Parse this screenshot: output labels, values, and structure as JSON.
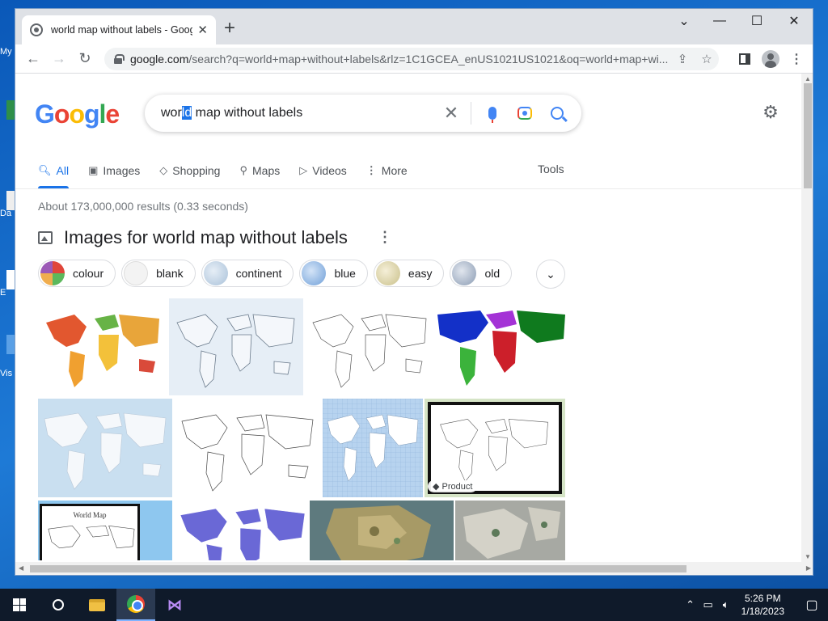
{
  "desktop": {
    "fragments": [
      "My",
      "Da",
      "E",
      "Vis"
    ]
  },
  "browser": {
    "tab_title": "world map without labels - Goog",
    "new_tab_label": "+",
    "url_host": "google.com",
    "url_path": "/search?q=world+map+without+labels&rlz=1C1GCEA_enUS1021US1021&oq=world+map+wi...",
    "window_controls": {
      "collapse": "⌄",
      "minimize": "—",
      "maximize": "☐",
      "close": "✕"
    }
  },
  "page": {
    "logo": {
      "G": "G",
      "o1": "o",
      "o2": "o",
      "g": "g",
      "l": "l",
      "e": "e"
    },
    "query_before": "wor",
    "query_selected": "ld",
    "query_after": " map without labels",
    "tabs": [
      {
        "label": "All",
        "icon": "search-icon"
      },
      {
        "label": "Images",
        "icon": "image-icon"
      },
      {
        "label": "Shopping",
        "icon": "tag-icon"
      },
      {
        "label": "Maps",
        "icon": "pin-icon"
      },
      {
        "label": "Videos",
        "icon": "play-icon"
      },
      {
        "label": "More",
        "icon": "kebab-icon"
      }
    ],
    "tools_label": "Tools",
    "result_stats": "About 173,000,000 results (0.33 seconds)",
    "images_header": "Images for world map without labels",
    "chips": [
      {
        "label": "colour"
      },
      {
        "label": "blank"
      },
      {
        "label": "continent"
      },
      {
        "label": "blue"
      },
      {
        "label": "easy"
      },
      {
        "label": "old"
      }
    ],
    "product_badge": "Product",
    "world_map_caption": "World Map"
  },
  "taskbar": {
    "time": "5:26 PM",
    "date": "1/18/2023"
  },
  "colors": {
    "accent": "#1a73e8",
    "google_blue": "#4285f4",
    "google_red": "#ea4335",
    "google_yellow": "#fbbc05",
    "google_green": "#34a853"
  }
}
